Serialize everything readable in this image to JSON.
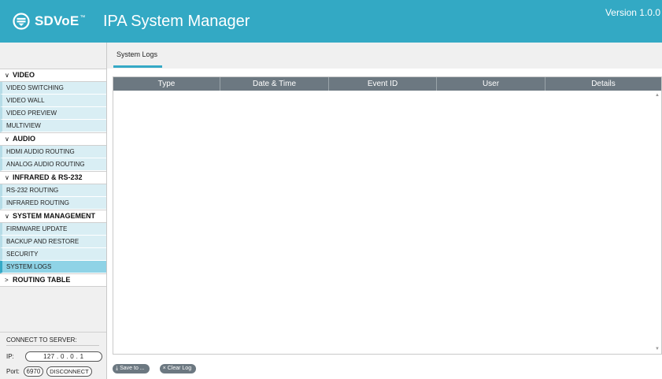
{
  "header": {
    "logo_text": "SDVoE",
    "logo_tm": "™",
    "title": "IPA System Manager",
    "version": "Version 1.0.0"
  },
  "tabs": [
    {
      "label": "System Logs",
      "active": true
    }
  ],
  "nav": {
    "video": {
      "label": "VIDEO",
      "items": [
        "VIDEO SWITCHING",
        "VIDEO WALL",
        "VIDEO PREVIEW",
        "MULTIVIEW"
      ]
    },
    "audio": {
      "label": "AUDIO",
      "items": [
        "HDMI AUDIO ROUTING",
        "ANALOG AUDIO ROUTING"
      ]
    },
    "infrared": {
      "label": "INFRARED & RS-232",
      "items": [
        "RS-232 ROUTING",
        "INFRARED ROUTING"
      ]
    },
    "system": {
      "label": "SYSTEM MANAGEMENT",
      "items": [
        "FIRMWARE UPDATE",
        "BACKUP AND RESTORE",
        "SECURITY",
        "SYSTEM LOGS"
      ],
      "active_item": "SYSTEM LOGS"
    },
    "routing": {
      "label": "ROUTING TABLE"
    }
  },
  "connect": {
    "title": "CONNECT TO SERVER:",
    "ip_label": "IP:",
    "ip_value": "127 . 0 . 0 . 1",
    "port_label": "Port:",
    "port_value": "6970",
    "disconnect_label": "DISCONNECT"
  },
  "log_table": {
    "columns": [
      "Type",
      "Date & Time",
      "Event ID",
      "User",
      "Details"
    ],
    "rows": []
  },
  "actions": {
    "save_label": "Save to ...",
    "clear_label": "Clear Log"
  },
  "colors": {
    "brand": "#33a9c4",
    "nav_item_bg": "#d9eef4",
    "nav_active_bg": "#8fd3e6",
    "table_header_bg": "#6c7881"
  },
  "icons": {
    "logo": "sdvoe-logo-icon",
    "save": "download-icon",
    "clear": "close-icon",
    "expanded": "chevron-down-icon",
    "collapsed": "chevron-right-icon"
  }
}
